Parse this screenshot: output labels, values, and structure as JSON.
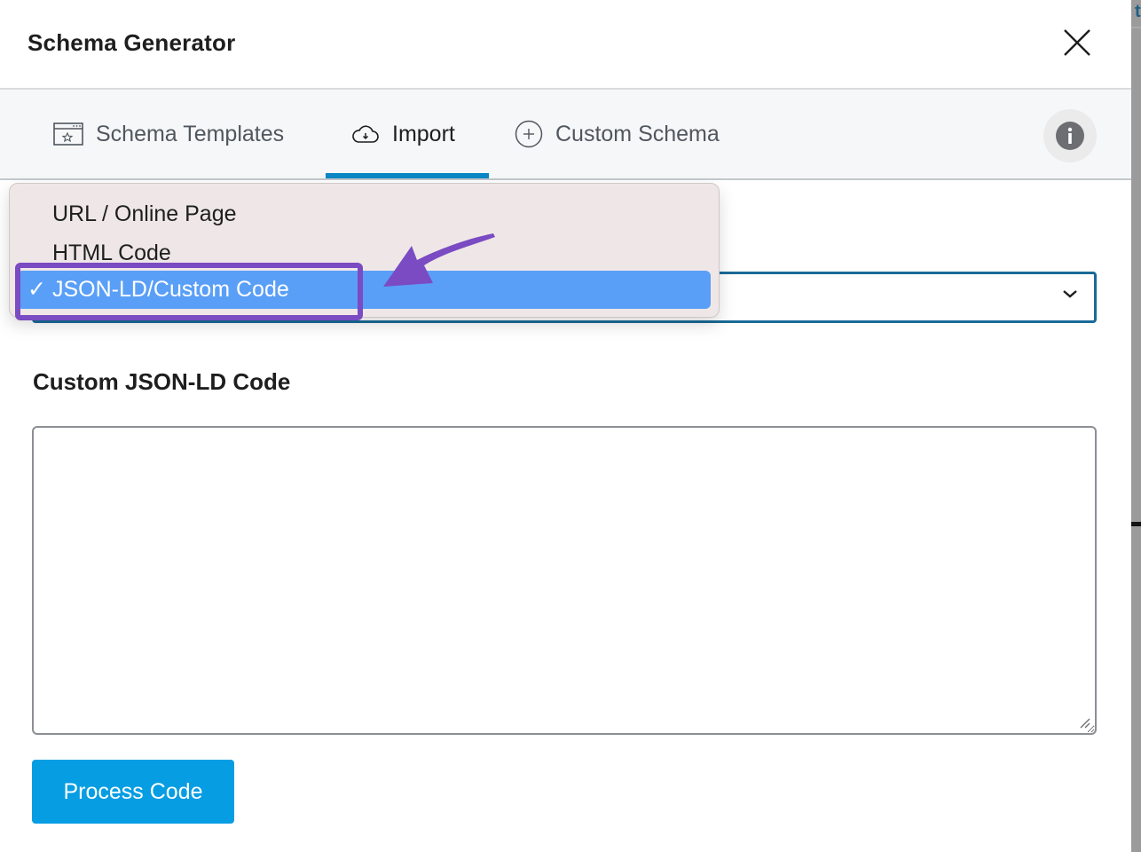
{
  "modal": {
    "title": "Schema Generator",
    "close_icon": "close-icon"
  },
  "tabs": [
    {
      "label": "Schema Templates",
      "icon": "schema-template-icon",
      "active": false
    },
    {
      "label": "Import",
      "icon": "cloud-download-icon",
      "active": true
    },
    {
      "label": "Custom Schema",
      "icon": "plus-circle-icon",
      "active": false
    }
  ],
  "info_button": {
    "icon": "info-icon"
  },
  "import_type_select": {
    "selected": "JSON-LD/Custom Code",
    "options": [
      "URL / Online Page",
      "HTML Code",
      "JSON-LD/Custom Code"
    ],
    "check_mark": "✓"
  },
  "custom_code": {
    "label": "Custom JSON-LD Code",
    "value": "",
    "placeholder": ""
  },
  "process_button": {
    "label": "Process Code"
  },
  "background_peek": {
    "text": "t"
  },
  "colors": {
    "accent": "#0a87c4",
    "button": "#069de3",
    "select_border": "#1a6a97",
    "dropdown_highlight": "#5a9ff7",
    "annotation": "#7a4bc2"
  }
}
